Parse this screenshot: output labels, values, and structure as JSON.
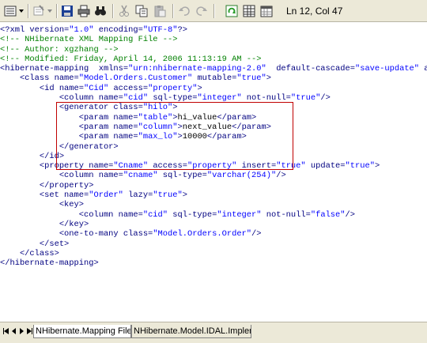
{
  "toolbar": {
    "status": "Ln 12, Col 47",
    "icons": [
      "list-icon",
      "dropdown-icon",
      "comment-icon",
      "dropdown-icon",
      "save-icon",
      "print-icon",
      "find-icon",
      "cut-icon",
      "copy-icon",
      "paste-icon",
      "undo-icon",
      "redo-icon",
      "refresh-icon",
      "grid-icon",
      "calendar-icon"
    ]
  },
  "code_lines": [
    [
      {
        "t": "<?xml version=",
        "c": "tag"
      },
      {
        "t": "\"1.0\"",
        "c": "val"
      },
      {
        "t": " encoding=",
        "c": "tag"
      },
      {
        "t": "\"UTF-8\"",
        "c": "val"
      },
      {
        "t": "?>",
        "c": "tag"
      }
    ],
    [
      {
        "t": "<!-- NHibernate XML Mapping File -->",
        "c": "comment"
      }
    ],
    [
      {
        "t": "<!-- Author: xgzhang -->",
        "c": "comment"
      }
    ],
    [
      {
        "t": "<!-- Modified: Friday, April 14, 2006 11:13:19 AM -->",
        "c": "comment"
      }
    ],
    [
      {
        "t": "<hibernate-mapping  xmlns=",
        "c": "tag"
      },
      {
        "t": "\"urn:nhibernate-mapping-2.0\"",
        "c": "val"
      },
      {
        "t": "  default-cascade=",
        "c": "tag"
      },
      {
        "t": "\"save-update\"",
        "c": "val"
      },
      {
        "t": " a",
        "c": "tag"
      }
    ],
    [
      {
        "t": "    <class name=",
        "c": "tag"
      },
      {
        "t": "\"Model.Orders.Customer\"",
        "c": "val"
      },
      {
        "t": " mutable=",
        "c": "tag"
      },
      {
        "t": "\"true\"",
        "c": "val"
      },
      {
        "t": ">",
        "c": "tag"
      }
    ],
    [
      {
        "t": "        <id name=",
        "c": "tag"
      },
      {
        "t": "\"Cid\"",
        "c": "val"
      },
      {
        "t": " access=",
        "c": "tag"
      },
      {
        "t": "\"property\"",
        "c": "val"
      },
      {
        "t": ">",
        "c": "tag"
      }
    ],
    [
      {
        "t": "            <column name=",
        "c": "tag"
      },
      {
        "t": "\"cid\"",
        "c": "val"
      },
      {
        "t": " sql-type=",
        "c": "tag"
      },
      {
        "t": "\"integer\"",
        "c": "val"
      },
      {
        "t": " not-null=",
        "c": "tag"
      },
      {
        "t": "\"true\"",
        "c": "val"
      },
      {
        "t": "/>",
        "c": "tag"
      }
    ],
    [
      {
        "t": "            <generator class=",
        "c": "tag"
      },
      {
        "t": "\"hilo\"",
        "c": "val"
      },
      {
        "t": ">",
        "c": "tag"
      }
    ],
    [
      {
        "t": "                <param name=",
        "c": "tag"
      },
      {
        "t": "\"table\"",
        "c": "val"
      },
      {
        "t": ">",
        "c": "tag"
      },
      {
        "t": "hi_value",
        "c": "text"
      },
      {
        "t": "</param>",
        "c": "tag"
      }
    ],
    [
      {
        "t": "                <param name=",
        "c": "tag"
      },
      {
        "t": "\"column\"",
        "c": "val"
      },
      {
        "t": ">",
        "c": "tag"
      },
      {
        "t": "next_value",
        "c": "text"
      },
      {
        "t": "</param>",
        "c": "tag"
      }
    ],
    [
      {
        "t": "                <param name=",
        "c": "tag"
      },
      {
        "t": "\"max_lo\"",
        "c": "val"
      },
      {
        "t": ">",
        "c": "tag"
      },
      {
        "t": "10000",
        "c": "text"
      },
      {
        "t": "</param>",
        "c": "tag"
      }
    ],
    [
      {
        "t": "            </generator>",
        "c": "tag"
      }
    ],
    [
      {
        "t": "        </id>",
        "c": "tag"
      }
    ],
    [
      {
        "t": "        <property name=",
        "c": "tag"
      },
      {
        "t": "\"Cname\"",
        "c": "val"
      },
      {
        "t": " access=",
        "c": "tag"
      },
      {
        "t": "\"property\"",
        "c": "val"
      },
      {
        "t": " insert=",
        "c": "tag"
      },
      {
        "t": "\"true\"",
        "c": "val"
      },
      {
        "t": " update=",
        "c": "tag"
      },
      {
        "t": "\"true\"",
        "c": "val"
      },
      {
        "t": ">",
        "c": "tag"
      }
    ],
    [
      {
        "t": "            <column name=",
        "c": "tag"
      },
      {
        "t": "\"cname\"",
        "c": "val"
      },
      {
        "t": " sql-type=",
        "c": "tag"
      },
      {
        "t": "\"varchar(254)\"",
        "c": "val"
      },
      {
        "t": "/>",
        "c": "tag"
      }
    ],
    [
      {
        "t": "        </property>",
        "c": "tag"
      }
    ],
    [
      {
        "t": "        <set name=",
        "c": "tag"
      },
      {
        "t": "\"Order\"",
        "c": "val"
      },
      {
        "t": " lazy=",
        "c": "tag"
      },
      {
        "t": "\"true\"",
        "c": "val"
      },
      {
        "t": ">",
        "c": "tag"
      }
    ],
    [
      {
        "t": "            <key>",
        "c": "tag"
      }
    ],
    [
      {
        "t": "                <column name=",
        "c": "tag"
      },
      {
        "t": "\"cid\"",
        "c": "val"
      },
      {
        "t": " sql-type=",
        "c": "tag"
      },
      {
        "t": "\"integer\"",
        "c": "val"
      },
      {
        "t": " not-null=",
        "c": "tag"
      },
      {
        "t": "\"false\"",
        "c": "val"
      },
      {
        "t": "/>",
        "c": "tag"
      }
    ],
    [
      {
        "t": "            </key>",
        "c": "tag"
      }
    ],
    [
      {
        "t": "            <one-to-many class=",
        "c": "tag"
      },
      {
        "t": "\"Model.Orders.Order\"",
        "c": "val"
      },
      {
        "t": "/>",
        "c": "tag"
      }
    ],
    [
      {
        "t": "        </set>",
        "c": "tag"
      }
    ],
    [
      {
        "t": "    </class>",
        "c": "tag"
      }
    ],
    [
      {
        "t": "</hibernate-mapping>",
        "c": "tag"
      }
    ]
  ],
  "tabs": [
    {
      "label": "NHibernate.Mapping File",
      "active": true
    },
    {
      "label": "NHibernate.Model.IDAL.Implem",
      "active": false
    }
  ],
  "colors": {
    "comment": "#008000",
    "value": "#0000ff",
    "tag": "#000080",
    "text": "#000000",
    "highlight_border": "#c00000"
  }
}
